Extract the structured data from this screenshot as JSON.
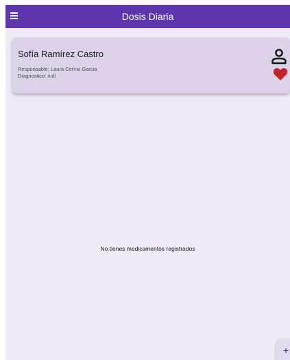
{
  "app_bar": {
    "title": "Dosis Diaria",
    "menu_icon": "menu-icon"
  },
  "patient_card": {
    "name": "Sofía Ramírez Castro",
    "responsable": "Responsable: Laura Cerino Garcia",
    "diagnostico": "Diagnostico: null",
    "person_icon": "person-icon",
    "heart_icon": "heart-icon"
  },
  "empty_state": {
    "message": "No tienes medicamentos registrados"
  },
  "fab": {
    "icon": "plus-icon",
    "symbol": "+"
  },
  "colors": {
    "primary": "#5b36ad",
    "background": "#f0eaf6",
    "card": "#dcd3e9",
    "heart": "#c3222c"
  }
}
